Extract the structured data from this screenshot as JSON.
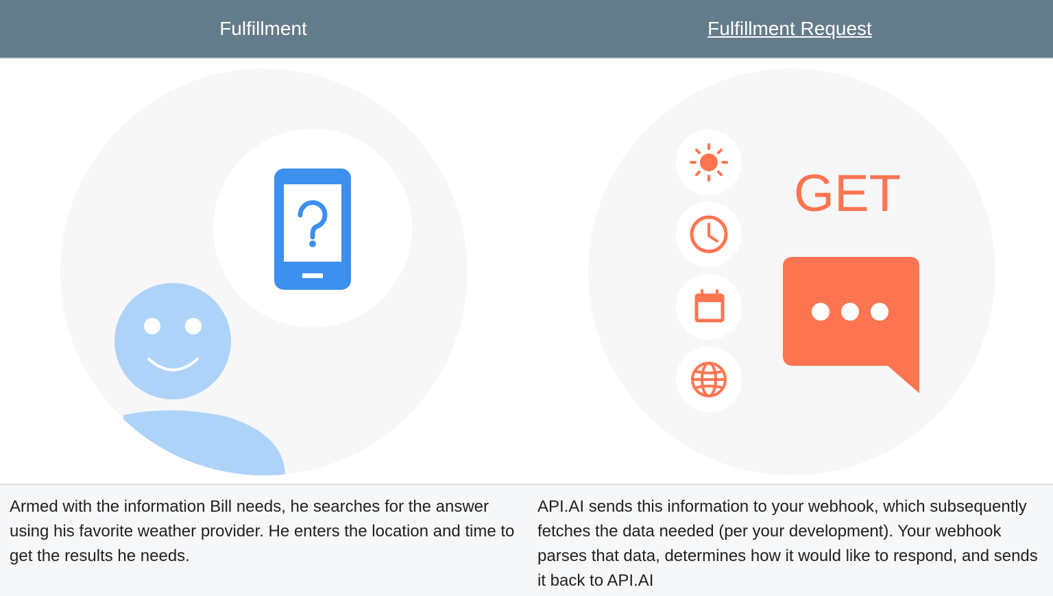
{
  "header": {
    "left_title": "Fulfillment",
    "right_title": "Fulfillment Request"
  },
  "illustration_left": {
    "icons": [
      "smiley-person-icon",
      "smartphone-question-icon"
    ],
    "colors": {
      "phone": "#3d8ff0",
      "person": "#aed3f8",
      "circle_bg": "#f7f7f8"
    }
  },
  "illustration_right": {
    "method_label": "GET",
    "icons": [
      "sun-icon",
      "clock-icon",
      "calendar-icon",
      "globe-icon",
      "chat-bubble-icon"
    ],
    "colors": {
      "accent": "#ff7551"
    }
  },
  "captions": {
    "left": "Armed with the information Bill needs, he searches for the answer using his favorite weather provider. He enters the location and time to get the results he needs.",
    "right": "API.AI sends this information to your webhook, which subsequently fetches the data needed (per your development). Your webhook parses that data, determines how it would like to respond, and sends it back to API.AI"
  }
}
